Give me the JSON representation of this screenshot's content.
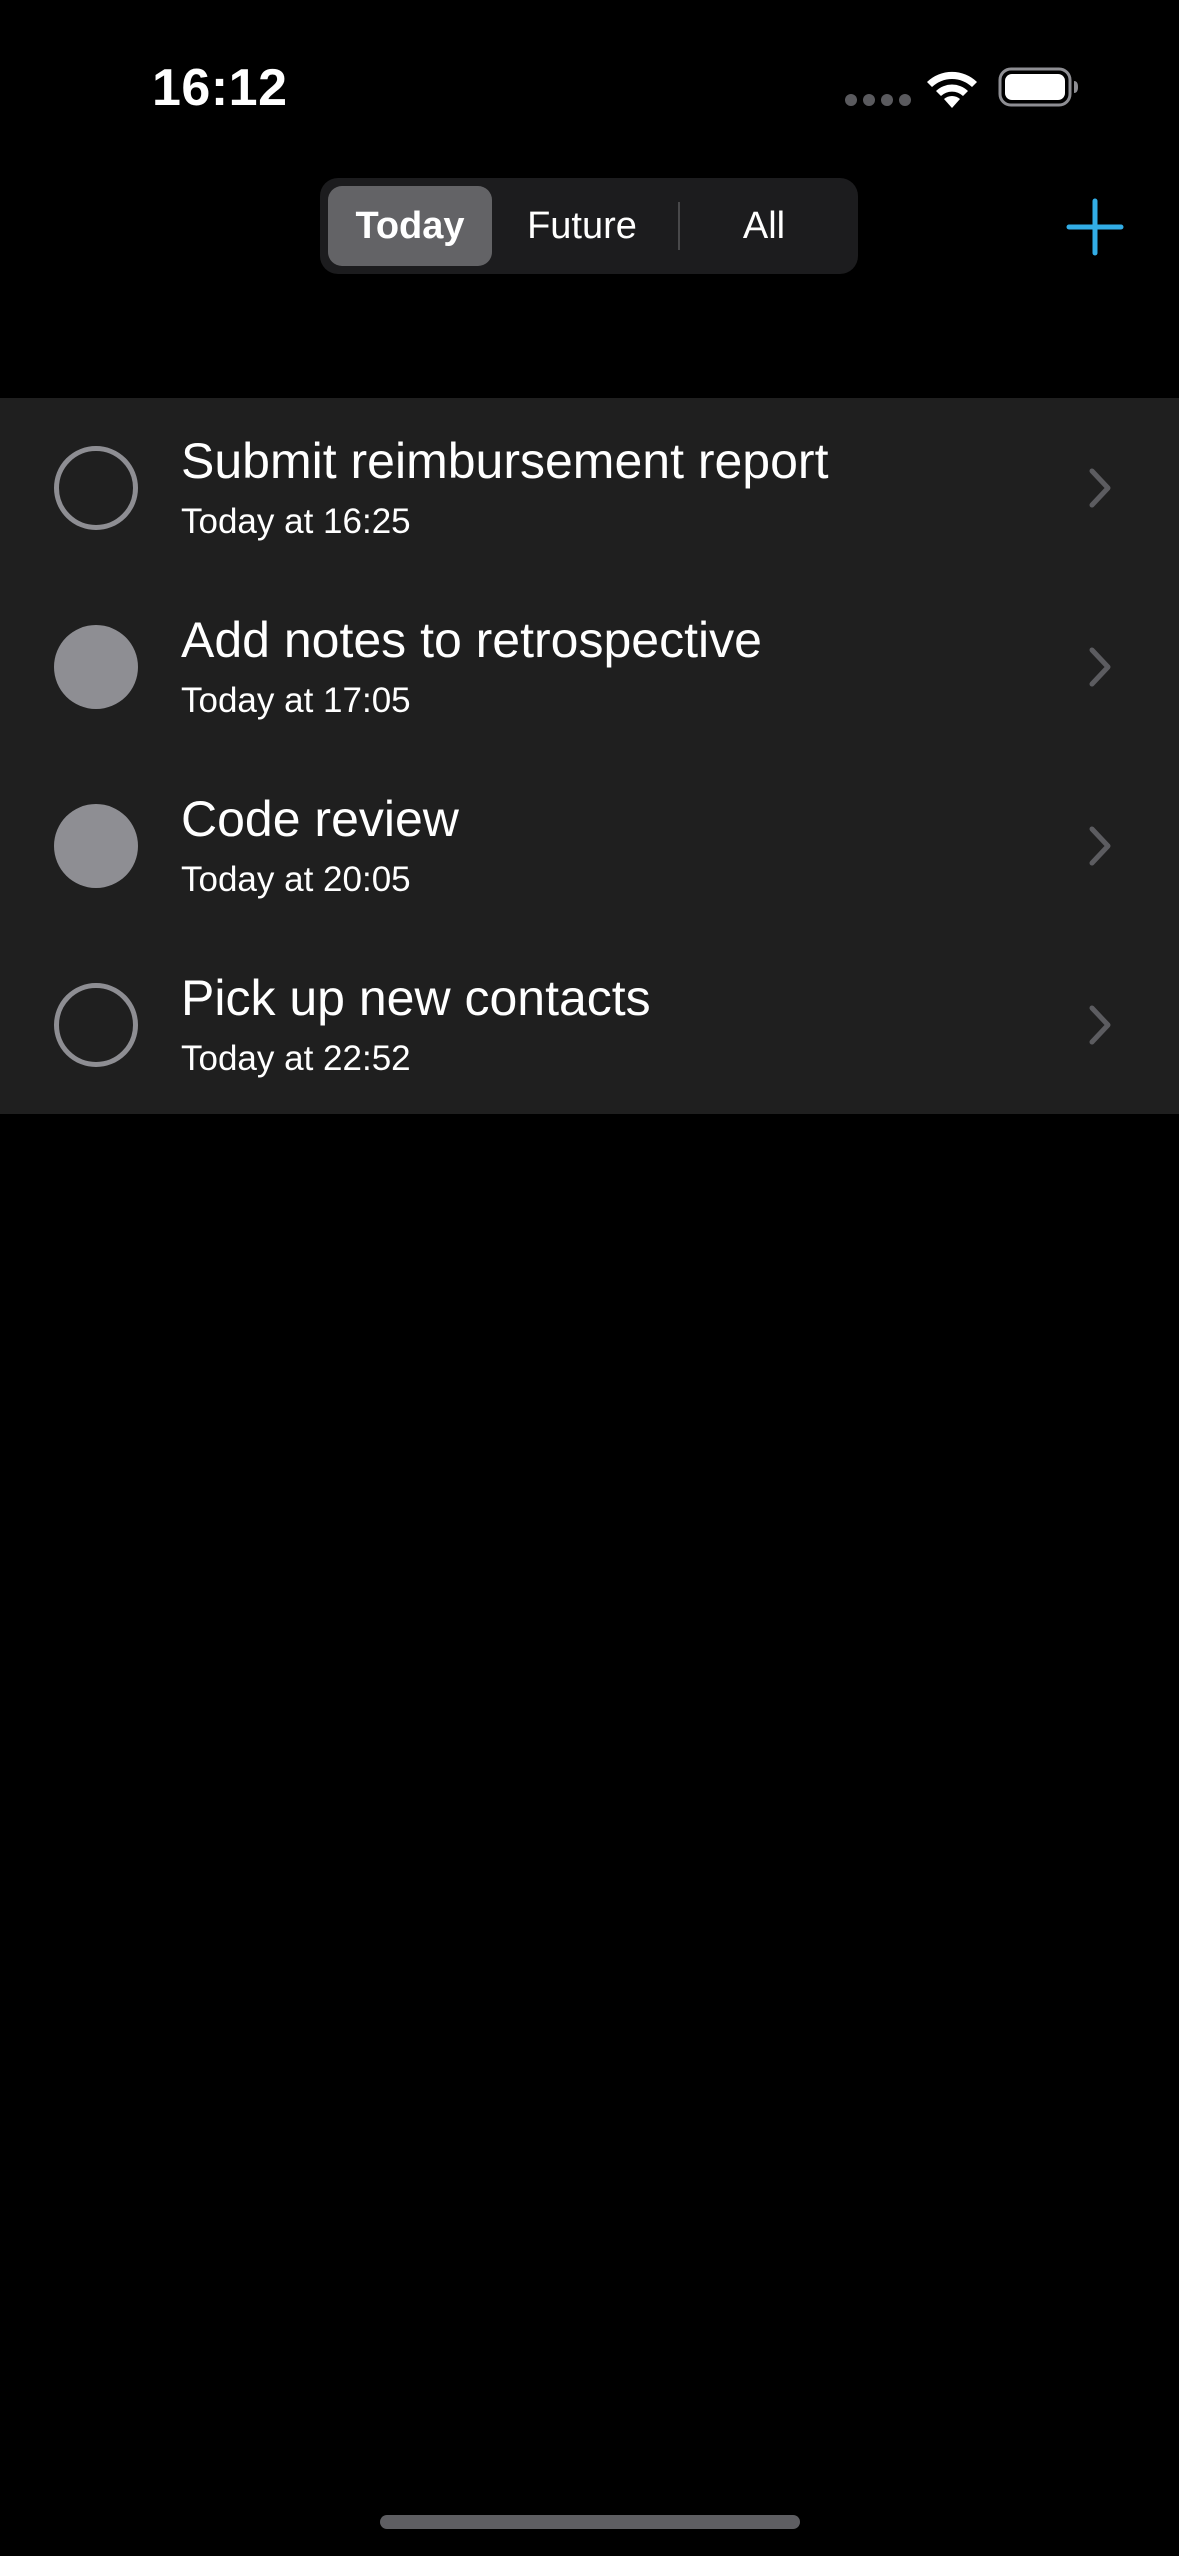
{
  "status_bar": {
    "time": "16:12"
  },
  "filter": {
    "segments": [
      {
        "label": "Today",
        "selected": true
      },
      {
        "label": "Future",
        "selected": false
      },
      {
        "label": "All",
        "selected": false
      }
    ]
  },
  "toolbar": {
    "add_icon": "plus-icon"
  },
  "tasks": [
    {
      "title": "Submit reimbursement report",
      "subtitle": "Today at 16:25",
      "completed": false
    },
    {
      "title": "Add notes to retrospective",
      "subtitle": "Today at 17:05",
      "completed": true
    },
    {
      "title": "Code review",
      "subtitle": "Today at 20:05",
      "completed": true
    },
    {
      "title": "Pick up new contacts",
      "subtitle": "Today at 22:52",
      "completed": false
    }
  ],
  "colors": {
    "accent": "#32ade6",
    "list_background": "#1f1f1f",
    "check_gray": "#8e8e93"
  }
}
